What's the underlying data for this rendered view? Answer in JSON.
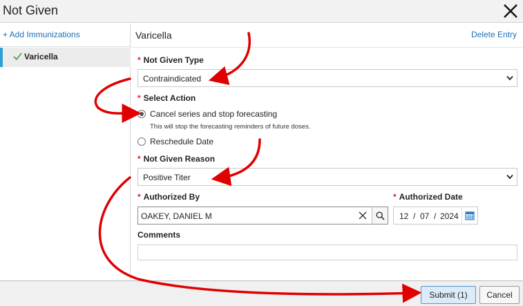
{
  "window": {
    "title": "Not Given"
  },
  "sidebar": {
    "add_link": "+ Add Immunizations",
    "items": [
      {
        "label": "Varicella",
        "selected": true
      }
    ]
  },
  "main": {
    "title": "Varicella",
    "delete_link": "Delete Entry",
    "not_given_type": {
      "label": "Not Given Type",
      "value": "Contraindicated"
    },
    "select_action": {
      "label": "Select Action",
      "options": [
        {
          "label": "Cancel series and stop forecasting",
          "hint": "This will stop the forecasting reminders of future doses.",
          "selected": true
        },
        {
          "label": "Reschedule Date",
          "selected": false
        }
      ]
    },
    "not_given_reason": {
      "label": "Not Given Reason",
      "value": "Positive Titer"
    },
    "authorized_by": {
      "label": "Authorized By",
      "value": "OAKEY, DANIEL M"
    },
    "authorized_date": {
      "label": "Authorized Date",
      "month": "12",
      "day": "07",
      "year": "2024",
      "separator": "/"
    },
    "comments": {
      "label": "Comments",
      "value": ""
    }
  },
  "footer": {
    "submit_label": "Submit (1)",
    "cancel_label": "Cancel"
  },
  "required_marker": "*",
  "colors": {
    "accent": "#2e9fd9",
    "link": "#1a6fb5",
    "required": "#dd2222",
    "annotation": "#e00000",
    "check": "#3aa14a"
  },
  "icons": [
    "close-icon",
    "check-icon",
    "chevron-down-icon",
    "clear-icon",
    "search-icon",
    "calendar-icon"
  ]
}
